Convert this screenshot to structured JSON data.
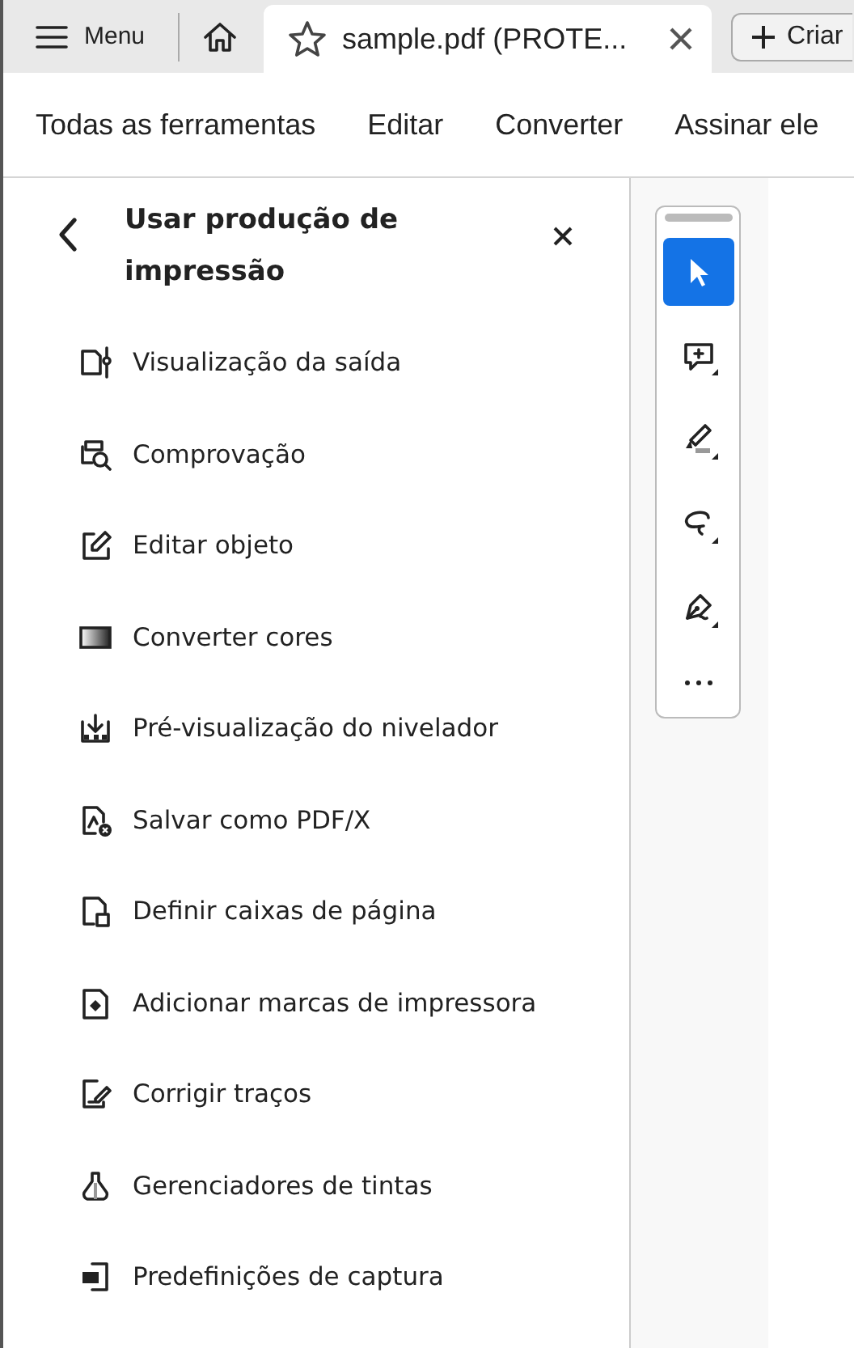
{
  "tab_bar": {
    "menu_button": {
      "label": "Menu"
    },
    "tabs": [
      {
        "label": "sample.pdf (PROTE...",
        "selected": true
      }
    ],
    "new_button": {
      "label": "Criar"
    }
  },
  "menu_bar": {
    "items": [
      {
        "label": "Todas as ferramentas"
      },
      {
        "label": "Editar"
      },
      {
        "label": "Converter"
      },
      {
        "label": "Assinar ele"
      }
    ]
  },
  "panel": {
    "title": "Usar produção de impressão",
    "items": [
      {
        "label": "Visualização da saída"
      },
      {
        "label": "Comprovação"
      },
      {
        "label": "Editar objeto"
      },
      {
        "label": "Converter cores"
      },
      {
        "label": "Pré-visualização do nivelador"
      },
      {
        "label": "Salvar como PDF/X"
      },
      {
        "label": "Definir caixas de página"
      },
      {
        "label": "Adicionar marcas de impressora"
      },
      {
        "label": "Corrigir traços"
      },
      {
        "label": "Gerenciadores de tintas"
      },
      {
        "label": "Predefinições de captura"
      }
    ]
  },
  "quick_tools": [
    {
      "selected": true
    },
    {
      "selected": false
    },
    {
      "selected": false
    },
    {
      "selected": false
    },
    {
      "selected": false
    }
  ]
}
